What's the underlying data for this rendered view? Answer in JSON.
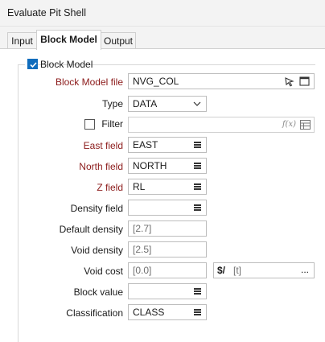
{
  "window": {
    "title": "Evaluate Pit Shell"
  },
  "tabs": [
    {
      "label": "Input"
    },
    {
      "label": "Block Model"
    },
    {
      "label": "Output"
    }
  ],
  "group": {
    "label": "Block Model",
    "checked": true
  },
  "form": {
    "block_model_file": {
      "label": "Block Model file",
      "value": "NVG_COL"
    },
    "type": {
      "label": "Type",
      "value": "DATA"
    },
    "filter": {
      "label": "Filter",
      "value": "",
      "function_hint": "f(x)"
    },
    "east_field": {
      "label": "East field",
      "value": "EAST"
    },
    "north_field": {
      "label": "North field",
      "value": "NORTH"
    },
    "z_field": {
      "label": "Z field",
      "value": "RL"
    },
    "density_field": {
      "label": "Density field",
      "value": ""
    },
    "default_density": {
      "label": "Default density",
      "placeholder": "[2.7]"
    },
    "void_density": {
      "label": "Void density",
      "placeholder": "[2.5]"
    },
    "void_cost": {
      "label": "Void cost",
      "placeholder": "[0.0]",
      "unit_symbol": "$/",
      "unit_placeholder": "[t]",
      "ellipsis": "..."
    },
    "block_value": {
      "label": "Block value",
      "value": ""
    },
    "classification": {
      "label": "Classification",
      "value": "CLASS"
    }
  },
  "colors": {
    "required_label": "#8b1a1a",
    "accent": "#0f6cbd"
  }
}
